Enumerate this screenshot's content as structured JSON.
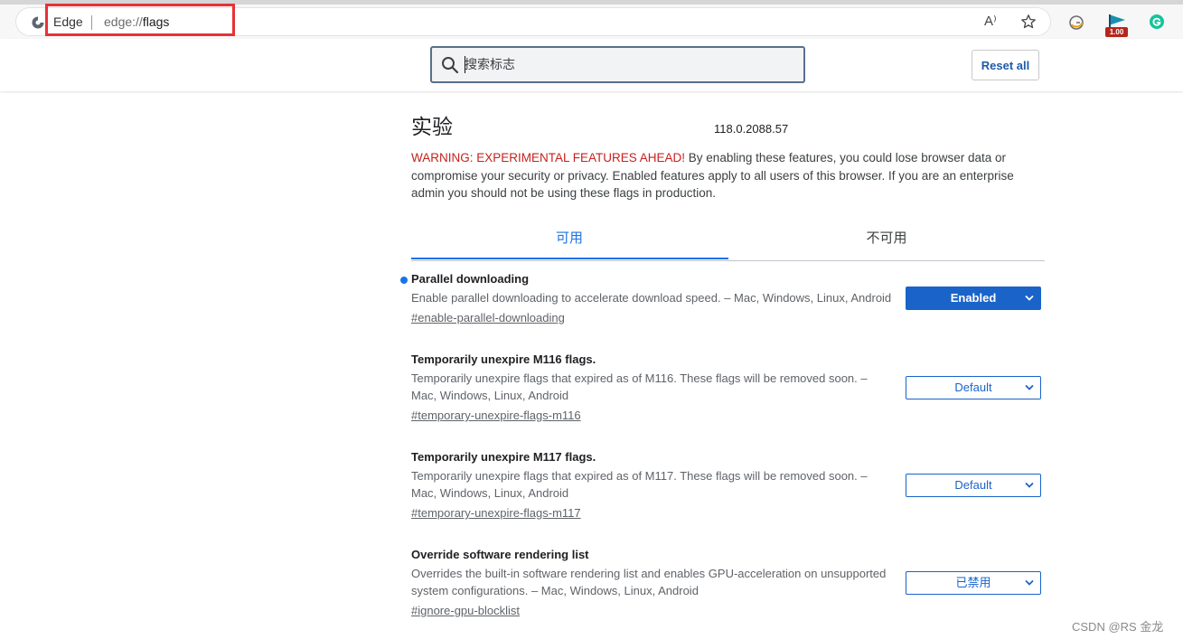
{
  "browser": {
    "site_label": "Edge",
    "url_scheme": "edge://",
    "url_host": "flags",
    "read_aloud_label": "A⁾",
    "extension_badge": "1.00"
  },
  "header": {
    "search_placeholder": "搜索标志",
    "reset_label": "Reset all"
  },
  "page": {
    "title": "实验",
    "version": "118.0.2088.57",
    "warning_prefix": "WARNING: EXPERIMENTAL FEATURES AHEAD!",
    "warning_body": " By enabling these features, you could lose browser data or compromise your security or privacy. Enabled features apply to all users of this browser. If you are an enterprise admin you should not be using these flags in production."
  },
  "tabs": [
    {
      "label": "可用",
      "active": true
    },
    {
      "label": "不可用",
      "active": false
    }
  ],
  "flags": [
    {
      "title": "Parallel downloading",
      "description": "Enable parallel downloading to accelerate download speed. – Mac, Windows, Linux, Android",
      "link": "#enable-parallel-downloading",
      "value": "Enabled",
      "modified": true
    },
    {
      "title": "Temporarily unexpire M116 flags.",
      "description": "Temporarily unexpire flags that expired as of M116. These flags will be removed soon. – Mac, Windows, Linux, Android",
      "link": "#temporary-unexpire-flags-m116",
      "value": "Default",
      "modified": false
    },
    {
      "title": "Temporarily unexpire M117 flags.",
      "description": "Temporarily unexpire flags that expired as of M117. These flags will be removed soon. – Mac, Windows, Linux, Android",
      "link": "#temporary-unexpire-flags-m117",
      "value": "Default",
      "modified": false
    },
    {
      "title": "Override software rendering list",
      "description": "Overrides the built-in software rendering list and enables GPU-acceleration on unsupported system configurations. – Mac, Windows, Linux, Android",
      "link": "#ignore-gpu-blocklist",
      "value": "已禁用",
      "modified": false
    }
  ],
  "watermark": "CSDN @RS 金龙",
  "colors": {
    "accent": "#1a73e8",
    "warning": "#c5221f",
    "annotation_box": "#e53238"
  }
}
